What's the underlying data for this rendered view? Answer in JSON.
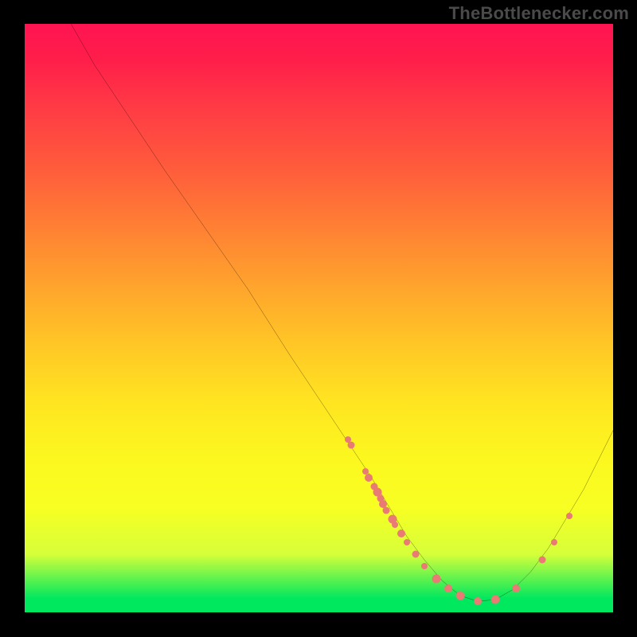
{
  "watermark": "TheBottlenecker.com",
  "chart_data": {
    "type": "line",
    "title": "",
    "xlabel": "",
    "ylabel": "",
    "xlim": [
      0,
      100
    ],
    "ylim": [
      0,
      100
    ],
    "background_gradient": {
      "top_color": "#ff1452",
      "mid_colors": [
        "#ff7e34",
        "#ffe421",
        "#f8ff22"
      ],
      "bottom_color": "#00e85e"
    },
    "curve": {
      "description": "Black valley curve descending from top-left, bottoming out near x≈77, rising toward right edge",
      "points_xy": [
        [
          8,
          100
        ],
        [
          12,
          93
        ],
        [
          18,
          84
        ],
        [
          24,
          75
        ],
        [
          31,
          65
        ],
        [
          38,
          55
        ],
        [
          45,
          44
        ],
        [
          51,
          35
        ],
        [
          55,
          29
        ],
        [
          59,
          23
        ],
        [
          62,
          18
        ],
        [
          65,
          13
        ],
        [
          68,
          9
        ],
        [
          71,
          5.5
        ],
        [
          74,
          3
        ],
        [
          77,
          2
        ],
        [
          80,
          2.3
        ],
        [
          83,
          4
        ],
        [
          86,
          7
        ],
        [
          89,
          11
        ],
        [
          92,
          16
        ],
        [
          95,
          21
        ],
        [
          98,
          27
        ],
        [
          100,
          31
        ]
      ]
    },
    "markers": {
      "description": "Salmon-colored dots lying along the curve, clustered on the descending limb and sparse on the ascending limb",
      "color": "#e97a74",
      "points_xysize": [
        [
          55.0,
          29.5,
          8
        ],
        [
          55.5,
          28.5,
          9
        ],
        [
          58.0,
          24.0,
          8
        ],
        [
          58.5,
          23.0,
          10
        ],
        [
          59.5,
          21.5,
          9
        ],
        [
          60.0,
          20.5,
          11
        ],
        [
          60.5,
          19.5,
          9
        ],
        [
          61.0,
          18.5,
          10
        ],
        [
          61.5,
          17.5,
          9
        ],
        [
          62.5,
          16.0,
          11
        ],
        [
          63.0,
          15.0,
          8
        ],
        [
          64.0,
          13.5,
          10
        ],
        [
          65.0,
          12.0,
          8
        ],
        [
          66.5,
          10.0,
          9
        ],
        [
          68.0,
          8.0,
          8
        ],
        [
          70.0,
          5.8,
          11
        ],
        [
          72.0,
          4.2,
          10
        ],
        [
          74.0,
          3.0,
          11
        ],
        [
          77.0,
          2.0,
          10
        ],
        [
          80.0,
          2.3,
          11
        ],
        [
          83.5,
          4.2,
          10
        ],
        [
          88.0,
          9.0,
          9
        ],
        [
          90.0,
          12.0,
          8
        ],
        [
          92.5,
          16.5,
          8
        ]
      ]
    }
  }
}
